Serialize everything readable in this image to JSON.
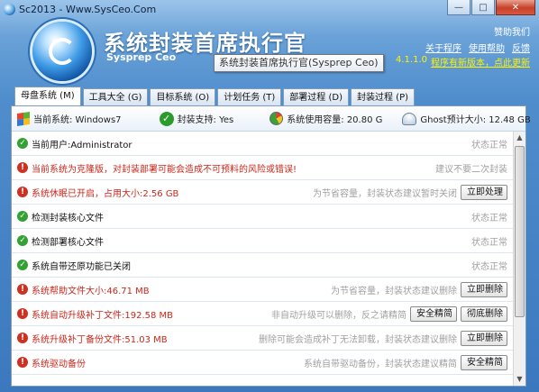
{
  "window": {
    "title": "Sc2013 - Www.SysCeo.Com",
    "controls": [
      "—",
      "□",
      "✕"
    ]
  },
  "header": {
    "app_name": "系统封装首席执行官",
    "app_sub": "Sysprep Ceo",
    "tooltip": "系统封装首席执行官(Sysprep Ceo)",
    "sponsor": "赞助我们",
    "links": [
      "关于程序",
      "使用帮助",
      "反馈"
    ],
    "version": "4.1.1.0",
    "update_link": "程序有新版本，点此更新"
  },
  "tabs": [
    {
      "label": "母盘系统 (M)",
      "active": true
    },
    {
      "label": "工具大全 (G)",
      "active": false
    },
    {
      "label": "目标系统 (O)",
      "active": false
    },
    {
      "label": "计划任务 (T)",
      "active": false
    },
    {
      "label": "部署过程 (D)",
      "active": false
    },
    {
      "label": "封装过程 (P)",
      "active": false
    }
  ],
  "status": {
    "current_system": "当前系统: Windows7",
    "pack_support": "封装支持: Yes",
    "used_capacity": "系统使用容量: 20.80 G",
    "ghost_size": "Ghost预计大小: 12.48 GB"
  },
  "rows": [
    {
      "type": "ok",
      "text": "当前用户:Administrator",
      "note": "状态正常",
      "buttons": []
    },
    {
      "type": "warn",
      "text": "当前系统为克隆版，对封装部署可能会造成不可预料的风险或错误!",
      "note": "建议不要二次封装",
      "buttons": []
    },
    {
      "type": "warn",
      "text": "系统休眠已开启，占用大小:2.56 GB",
      "note": "为节省容量，封装状态建议暂时关闭",
      "buttons": [
        "立即处理"
      ]
    },
    {
      "type": "ok",
      "text": "检测封装核心文件",
      "note": "状态正常",
      "buttons": []
    },
    {
      "type": "ok",
      "text": "检测部署核心文件",
      "note": "状态正常",
      "buttons": []
    },
    {
      "type": "ok",
      "text": "系统自带还原功能已关闭",
      "note": "状态正常",
      "buttons": []
    },
    {
      "type": "warn",
      "text": "系统帮助文件大小:46.71 MB",
      "note": "为节省容量，封装状态建议删除",
      "buttons": [
        "立即删除"
      ]
    },
    {
      "type": "warn",
      "text": "系统自动升级补丁文件:192.58 MB",
      "note": "非自动升级可以删除，反之请精简",
      "buttons": [
        "安全精简",
        "彻底删除"
      ]
    },
    {
      "type": "warn",
      "text": "系统升级补丁备份文件:51.03 MB",
      "note": "删除可能会造成补丁无法卸载，封装状态建议删除",
      "buttons": [
        "立即删除"
      ]
    },
    {
      "type": "warn",
      "text": "系统驱动备份",
      "note": "系统自带驱动备份，封装状态建议精简",
      "buttons": [
        "安全精简"
      ]
    }
  ],
  "colors": {
    "ok": "#33a133",
    "warn": "#cc3121",
    "warn_text": "#c8281c",
    "note_text": "#a0a0a0",
    "accent": "#3b78be"
  }
}
